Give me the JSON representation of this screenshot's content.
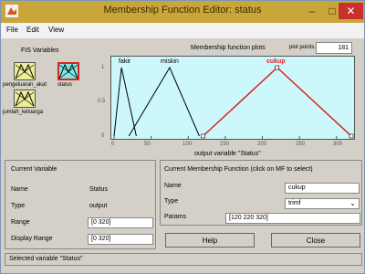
{
  "window": {
    "title": "Membership Function Editor: status"
  },
  "menu": [
    "File",
    "Edit",
    "View"
  ],
  "fis": {
    "label": "FIS Variables",
    "inputs": [
      "pengeluaran_akat",
      "jumlah_keluarga"
    ],
    "output": "status"
  },
  "plot": {
    "title": "Membership function plots",
    "points_label": "plot points:",
    "points_value": "181",
    "xlabel": "output variable \"Status\"",
    "y_ticks": [
      "1",
      "0.5",
      "0"
    ],
    "x_ticks": [
      "0",
      "50",
      "100",
      "150",
      "200",
      "250",
      "300"
    ]
  },
  "chart_data": {
    "type": "line",
    "xlim": [
      0,
      320
    ],
    "ylim": [
      0,
      1
    ],
    "series": [
      {
        "name": "fakir",
        "points": [
          [
            0,
            0
          ],
          [
            10,
            1
          ],
          [
            30,
            0
          ]
        ],
        "color": "#000000"
      },
      {
        "name": "miskin",
        "points": [
          [
            20,
            0
          ],
          [
            75,
            1
          ],
          [
            115,
            0
          ]
        ],
        "color": "#000000"
      },
      {
        "name": "cukup",
        "points": [
          [
            120,
            0
          ],
          [
            220,
            1
          ],
          [
            320,
            0
          ]
        ],
        "color": "#dd2222"
      }
    ]
  },
  "current_variable": {
    "title": "Current Variable",
    "name_label": "Name",
    "name_value": "Status",
    "type_label": "Type",
    "type_value": "output",
    "range_label": "Range",
    "range_value": "[0 320]",
    "display_range_label": "Display Range",
    "display_range_value": "[0 320]"
  },
  "current_mf": {
    "title": "Current Membership Function (click on MF to select)",
    "name_label": "Name",
    "name_value": "cukup",
    "type_label": "Type",
    "type_value": "trimf",
    "params_label": "Params",
    "params_value": "[120 220 320]"
  },
  "buttons": {
    "help": "Help",
    "close": "Close"
  },
  "status": "Selected variable \"Status\"",
  "colors": {
    "titlebar": "#c9a63a",
    "plot_bg": "#ccf7fb",
    "active_mf": "#dd2222"
  }
}
